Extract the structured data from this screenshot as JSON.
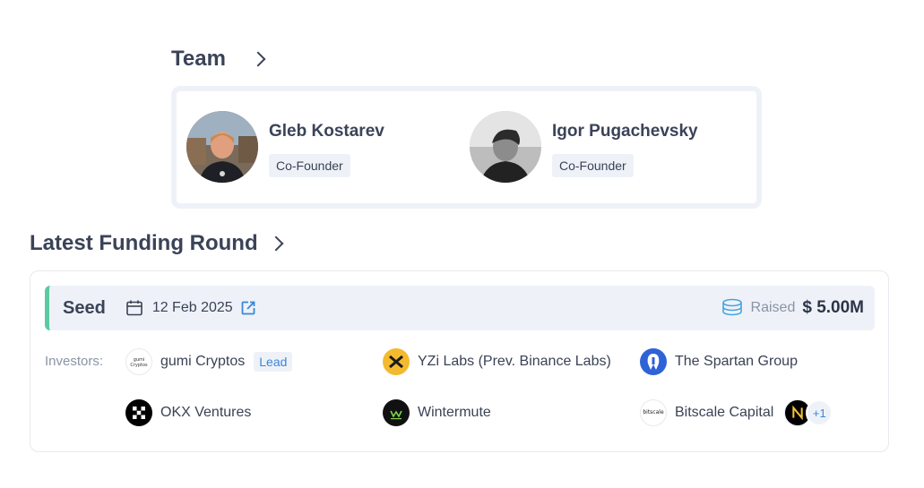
{
  "team": {
    "title": "Team",
    "members": [
      {
        "name": "Gleb Kostarev",
        "role": "Co-Founder"
      },
      {
        "name": "Igor Pugachevsky",
        "role": "Co-Founder"
      }
    ]
  },
  "funding": {
    "title": "Latest Funding Round",
    "round": {
      "stage": "Seed",
      "date": "12 Feb 2025",
      "raised_label": "Raised",
      "raised_value": "$ 5.00M"
    },
    "investors_label": "Investors:",
    "investors": [
      {
        "name": "gumi Cryptos",
        "badge": "Lead",
        "icon": "gumi-logo"
      },
      {
        "name": "YZi Labs (Prev. Binance Labs)",
        "icon": "yzi-logo"
      },
      {
        "name": "The Spartan Group",
        "icon": "spartan-logo"
      },
      {
        "name": "OKX Ventures",
        "icon": "okx-logo"
      },
      {
        "name": "Wintermute",
        "icon": "wintermute-logo"
      },
      {
        "name": "Bitscale Capital",
        "icon": "bitscale-logo"
      }
    ],
    "more_count": "+1",
    "colors": {
      "accent": "#5ccaa0",
      "link": "#3b86d8",
      "panel": "#eef2f8"
    }
  }
}
